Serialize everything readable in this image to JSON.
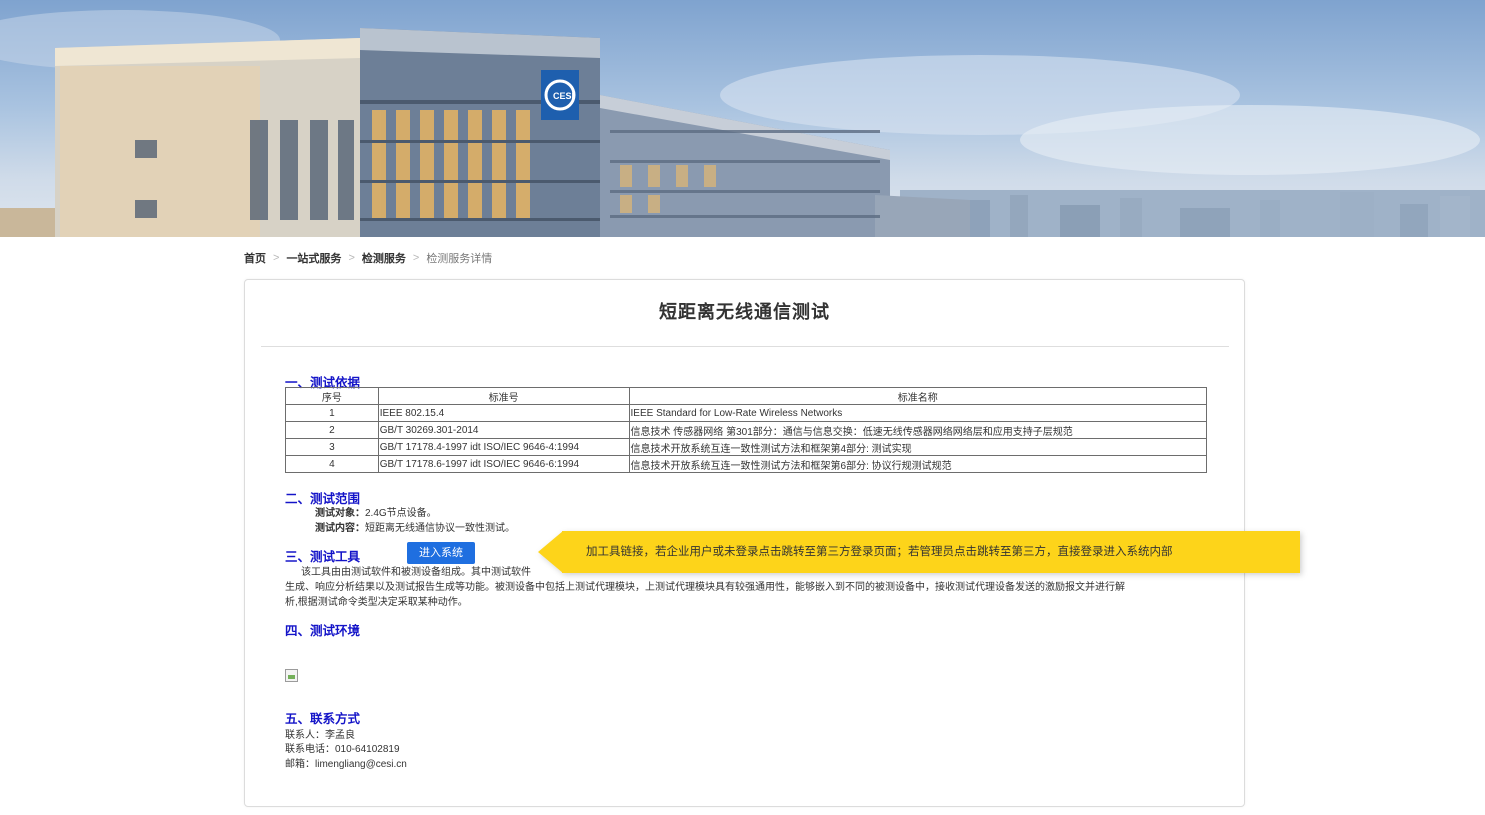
{
  "banner": {
    "logo_text": "CESI"
  },
  "breadcrumb": {
    "home": "首页",
    "service": "一站式服务",
    "testing": "检测服务",
    "current": "检测服务详情",
    "separator": ">"
  },
  "title": "短距离无线通信测试",
  "sections": {
    "basis": "一、测试依据",
    "scope": "二、测试范围",
    "tool": "三、测试工具",
    "env": "四、测试环境",
    "contact": "五、联系方式"
  },
  "table": {
    "headers": [
      "序号",
      "标准号",
      "标准名称"
    ],
    "rows": [
      {
        "no": "1",
        "code": "IEEE 802.15.4",
        "name": "IEEE Standard for Low-Rate Wireless Networks"
      },
      {
        "no": "2",
        "code": "GB/T 30269.301-2014",
        "name": "信息技术 传感器网络 第301部分：通信与信息交换：低速无线传感器网络网络层和应用支持子层规范"
      },
      {
        "no": "3",
        "code": "GB/T 17178.4-1997 idt ISO/IEC 9646-4:1994",
        "name": "信息技术开放系统互连一致性测试方法和框架第4部分: 测试实现"
      },
      {
        "no": "4",
        "code": "GB/T 17178.6-1997 idt ISO/IEC 9646-6:1994",
        "name": "信息技术开放系统互连一致性测试方法和框架第6部分: 协议行规测试规范"
      }
    ]
  },
  "scope": {
    "object_label": "测试对象：",
    "object_value": "2.4G节点设备。",
    "content_label": "测试内容：",
    "content_value": "短距离无线通信协议一致性测试。"
  },
  "tool": {
    "button": "进入系统",
    "line1": "该工具由由测试软件和被测设备组成。其中测试软件",
    "line2": "生成、响应分析结果以及测试报告生成等功能。被测设备中包括上测试代理模块，上测试代理模块具有较强通用性，能够嵌入到不同的被测设备中，接收测试代理设备发送的激励报文并进行解",
    "line3": "析,根据测试命令类型决定采取某种动作。"
  },
  "contact": {
    "person": "联系人：李孟良",
    "phone": "联系电话：010-64102819",
    "email": "邮箱：limengliang@cesi.cn"
  },
  "callout": {
    "text": "加工具链接，若企业用户或未登录点击跳转至第三方登录页面；若管理员点击跳转至第三方，直接登录进入系统内部"
  }
}
